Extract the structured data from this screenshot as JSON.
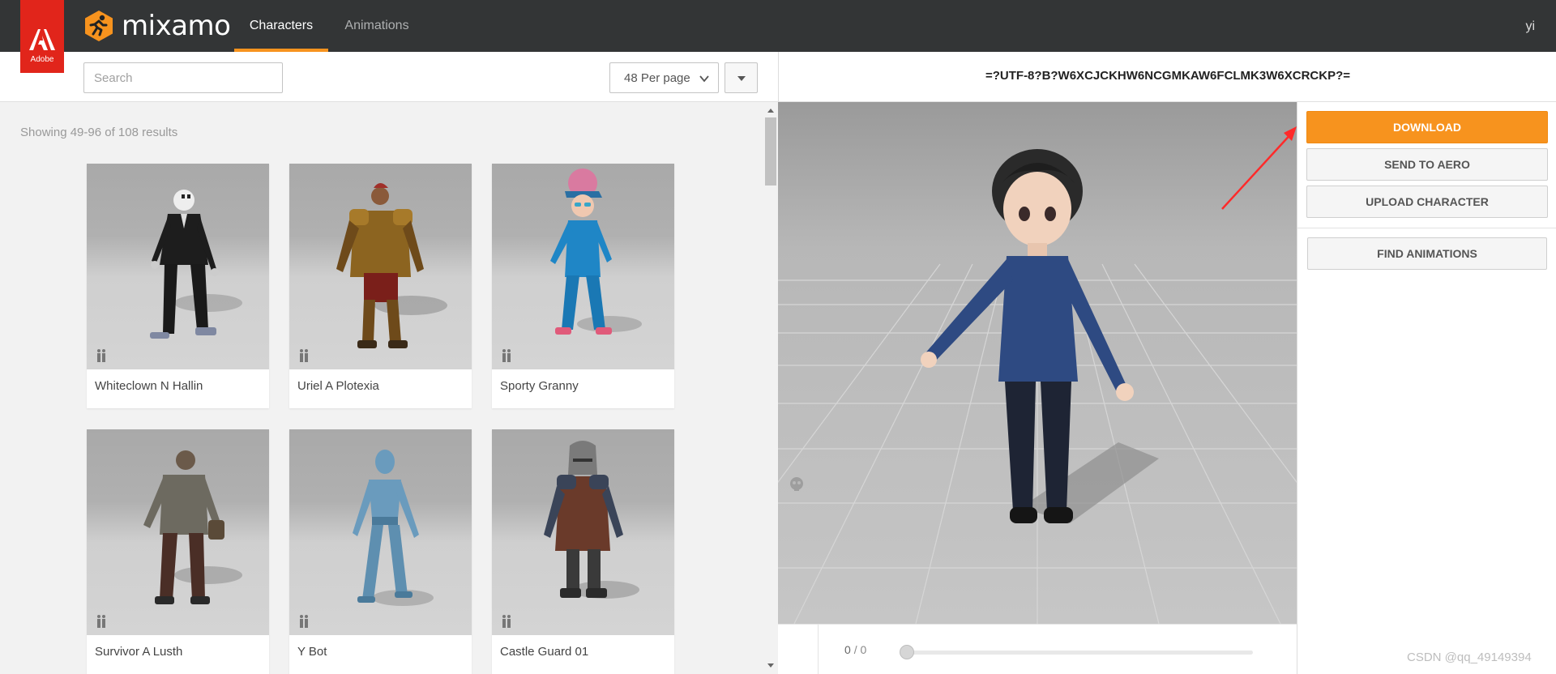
{
  "brand": {
    "adobe_label": "Adobe",
    "app_name": "mixamo"
  },
  "nav": {
    "tabs": [
      {
        "label": "Characters",
        "active": true
      },
      {
        "label": "Animations",
        "active": false
      }
    ],
    "user_initials": "yi"
  },
  "toolbar": {
    "search_placeholder": "Search",
    "per_page_selected": "48 Per page"
  },
  "results": {
    "summary": "Showing 49-96 of 108 results",
    "characters": [
      {
        "name": "Whiteclown N Hallin"
      },
      {
        "name": "Uriel A Plotexia"
      },
      {
        "name": "Sporty Granny"
      },
      {
        "name": "Survivor A Lusth"
      },
      {
        "name": "Y Bot"
      },
      {
        "name": "Castle Guard 01"
      }
    ]
  },
  "viewer": {
    "character_title": "=?UTF-8?B?W6XCJCKHW6NCGMKAW6FCLMK3W6XCRCKP?=",
    "frame_current": "0",
    "frame_separator": "/",
    "frame_total": "0",
    "playback_progress": 0
  },
  "actions": {
    "download": "DOWNLOAD",
    "send_to_aero": "SEND TO AERO",
    "upload_character": "UPLOAD CHARACTER",
    "find_animations": "FIND ANIMATIONS"
  },
  "colors": {
    "accent_orange": "#f7931e",
    "topbar": "#333536",
    "adobe_red": "#e1251b",
    "annotation_red": "#ff2a2a"
  },
  "watermark": "CSDN @qq_49149394"
}
